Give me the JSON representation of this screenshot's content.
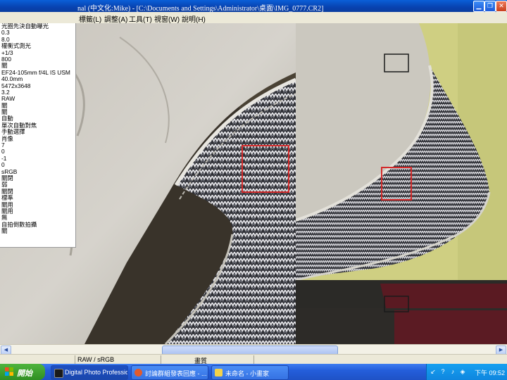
{
  "window": {
    "title": "nal (中文化:Mike) - [C:\\Documents and Settings\\Administrator\\桌面\\IMG_0777.CR2]"
  },
  "menu": [
    "標籤(L)",
    "調整(A)",
    "工具(T)",
    "視窗(W)",
    "說明(H)"
  ],
  "info_panel": [
    "光圈先決自動曝光",
    "0.3",
    "8.0",
    "權衡式測光",
    "+1/3",
    "800",
    "關",
    "EF24-105mm f/4L IS USM",
    "40.0mm",
    "5472x3648",
    "3.2",
    "RAW",
    "關",
    "關",
    "自動",
    "單次自動對焦",
    "手動選擇",
    "肖像",
    "7",
    "0",
    "-1",
    "0",
    "sRGB",
    "關閉",
    "弱",
    "關閉",
    "標準",
    "關用",
    "關用",
    "無",
    "自拍倒數拍攝",
    "關"
  ],
  "statusbar": {
    "format": "RAW / sRGB",
    "quality": "畫質"
  },
  "taskbar": {
    "start": "開始",
    "tasks": [
      {
        "label": "Digital Photo Professio...",
        "active": true
      },
      {
        "label": "討論群組發表回應 - ...",
        "active": false
      },
      {
        "label": "未命名 - 小畫家",
        "active": false
      }
    ],
    "clock": "下午 09:52"
  },
  "colors": {
    "titlebar": "#0a5fd8",
    "taskbar": "#245edb",
    "start": "#3a9f2c",
    "highlight_box": "#d42a2a"
  }
}
